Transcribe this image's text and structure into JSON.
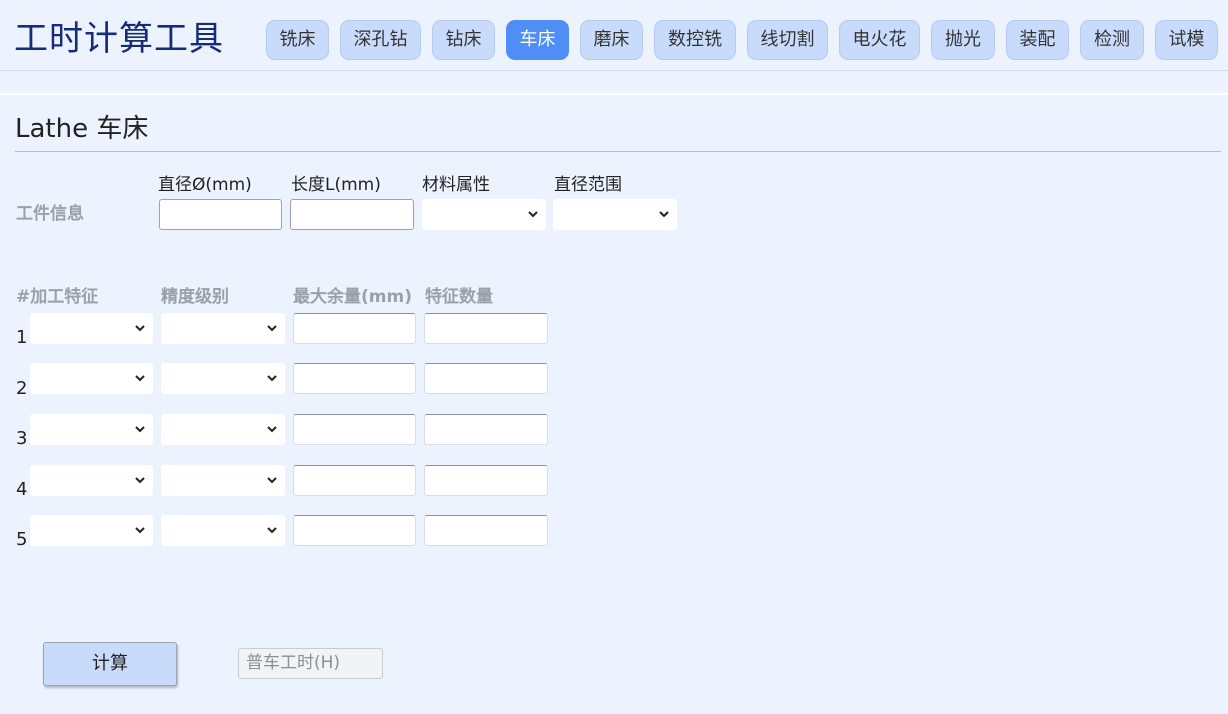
{
  "app": {
    "title": "工时计算工具"
  },
  "tabs": [
    {
      "label": "铣床"
    },
    {
      "label": "深孔钻"
    },
    {
      "label": "钻床"
    },
    {
      "label": "车床"
    },
    {
      "label": "磨床"
    },
    {
      "label": "数控铣"
    },
    {
      "label": "线切割"
    },
    {
      "label": "电火花"
    },
    {
      "label": "抛光"
    },
    {
      "label": "装配"
    },
    {
      "label": "检测"
    },
    {
      "label": "试模"
    }
  ],
  "active_tab": "车床",
  "section": {
    "title": "Lathe 车床"
  },
  "workpiece": {
    "row_label": "工件信息",
    "diameter": {
      "label": "直径Ø(mm)",
      "value": ""
    },
    "length": {
      "label": "长度L(mm)",
      "value": ""
    },
    "material": {
      "label": "材料属性",
      "value": ""
    },
    "diameter_range": {
      "label": "直径范围",
      "value": ""
    }
  },
  "features": {
    "headers": [
      "#加工特征",
      "精度级别",
      "最大余量(mm)",
      "特征数量"
    ],
    "rows": [
      {
        "num": "1",
        "feature": "",
        "precision": "",
        "max_allowance": "",
        "count": ""
      },
      {
        "num": "2",
        "feature": "",
        "precision": "",
        "max_allowance": "",
        "count": ""
      },
      {
        "num": "3",
        "feature": "",
        "precision": "",
        "max_allowance": "",
        "count": ""
      },
      {
        "num": "4",
        "feature": "",
        "precision": "",
        "max_allowance": "",
        "count": ""
      },
      {
        "num": "5",
        "feature": "",
        "precision": "",
        "max_allowance": "",
        "count": ""
      }
    ]
  },
  "actions": {
    "calculate_label": "计算",
    "result_placeholder": "普车工时(H)",
    "result_value": ""
  },
  "colors": {
    "background": "#ecf2fe",
    "tab": "#c9dbfb",
    "tab_active": "#4f8ff5",
    "title": "#152c78",
    "muted_label": "#9aa0a8"
  },
  "icons": {
    "select_arrow": "chevron-down-icon"
  }
}
